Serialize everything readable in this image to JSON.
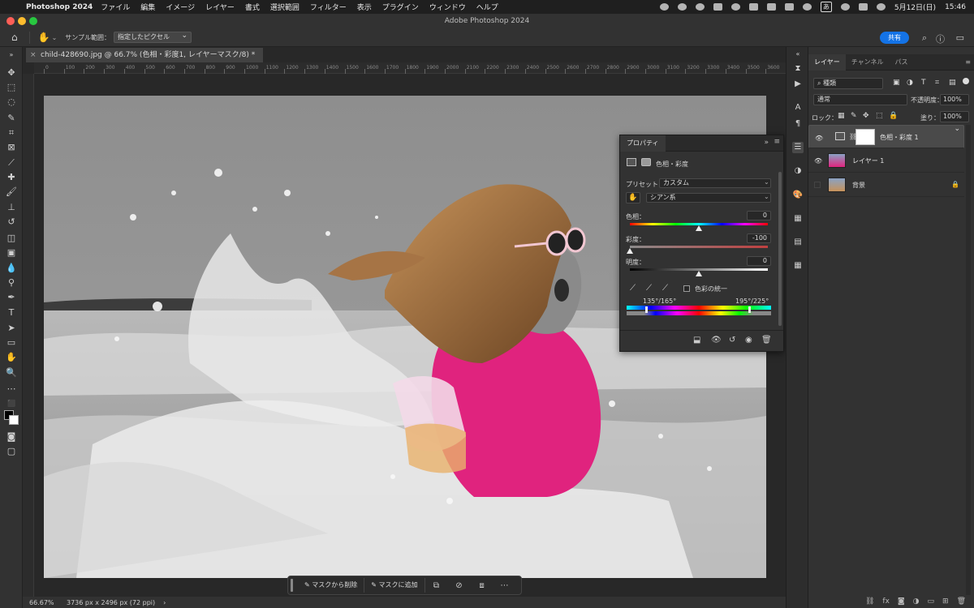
{
  "menubar": {
    "app": "Photoshop 2024",
    "items": [
      "ファイル",
      "編集",
      "イメージ",
      "レイヤー",
      "書式",
      "選択範囲",
      "フィルター",
      "表示",
      "プラグイン",
      "ウィンドウ",
      "ヘルプ"
    ],
    "ime": "あ",
    "date": "5月12日(日)",
    "time": "15:46"
  },
  "window": {
    "title": "Adobe Photoshop 2024"
  },
  "options": {
    "sample_label": "サンプル範囲：",
    "sample_value": "指定したピクセル",
    "share_label": "共有"
  },
  "document": {
    "tab_title": "child-428690.jpg @ 66.7% (色相・彩度1, レイヤーマスク/8) *",
    "ruler_labels": [
      "0",
      "100",
      "200",
      "300",
      "400",
      "500",
      "600",
      "700",
      "800",
      "900",
      "1000",
      "1100",
      "1200",
      "1300",
      "1400",
      "1500",
      "1600",
      "1700",
      "1800",
      "1900",
      "2000",
      "2100",
      "2200",
      "2300",
      "2400",
      "2500",
      "2600",
      "2700",
      "2800",
      "2900",
      "3000",
      "3100",
      "3200",
      "3300",
      "3400",
      "3500",
      "3600"
    ]
  },
  "context_bar": {
    "subtract_label": "マスクから削除",
    "add_label": "マスクに追加"
  },
  "status": {
    "zoom": "66.67%",
    "dimensions": "3736 px x 2496 px (72 ppi)"
  },
  "properties": {
    "tab": "プロパティ",
    "adjustment_title": "色相・彩度",
    "preset_label": "プリセット：",
    "preset_value": "カスタム",
    "channel_value": "シアン系",
    "hue_label": "色相：",
    "hue_value": "0",
    "saturation_label": "彩度：",
    "saturation_value": "-100",
    "lightness_label": "明度：",
    "lightness_value": "0",
    "colorize_label": "色彩の統一",
    "range_left": "135°/165°",
    "range_right": "195°/225°",
    "hue_level": 0,
    "saturation_level": -100,
    "lightness_level": 0
  },
  "layers_panel": {
    "tabs": [
      "レイヤー",
      "チャンネル",
      "パス"
    ],
    "filter_value": "種類",
    "blend_value": "通常",
    "opacity_label": "不透明度：",
    "opacity_value": "100%",
    "lock_label": "ロック：",
    "fill_label": "塗り：",
    "fill_value": "100%",
    "layers": [
      {
        "name": "色相・彩度 1",
        "visible": true,
        "selected": true
      },
      {
        "name": "レイヤー 1",
        "visible": true,
        "selected": false
      },
      {
        "name": "背景",
        "visible": false,
        "selected": false
      }
    ]
  },
  "colors": {
    "accent": "#1473e6",
    "shirt": "#e0237e"
  }
}
